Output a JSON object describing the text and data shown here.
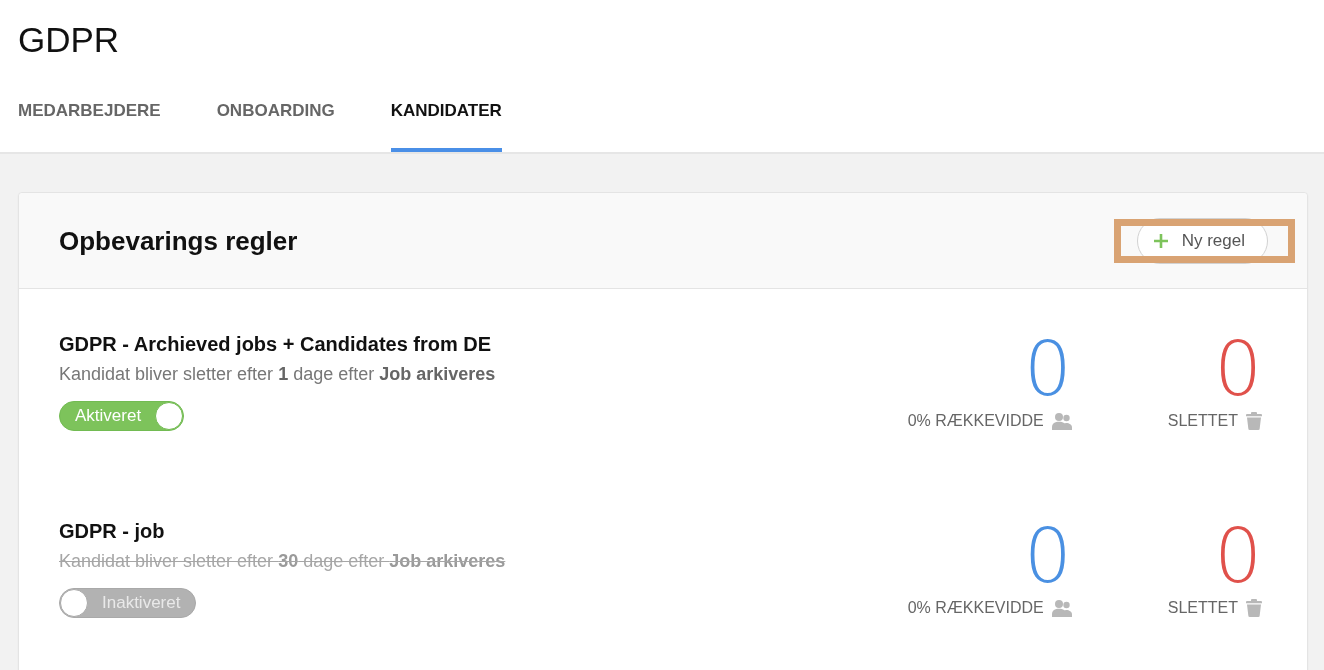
{
  "page": {
    "title": "GDPR"
  },
  "tabs": [
    {
      "label": "MEDARBEJDERE",
      "selected": false
    },
    {
      "label": "ONBOARDING",
      "selected": false
    },
    {
      "label": "KANDIDATER",
      "selected": true
    }
  ],
  "card": {
    "title": "Opbevarings regler",
    "new_rule_button": {
      "label": "Ny regel",
      "highlighted": true
    },
    "rules": [
      {
        "name": "GDPR - Archieved jobs + Candidates from DE",
        "description": "Kandidat bliver sletter efter **1** dage efter **Job arkiveres**",
        "active": true,
        "status_label": "Aktiveret",
        "stats": [
          {
            "kind": "reach",
            "count": "0",
            "label": "0% RÆKKEVIDDE"
          },
          {
            "kind": "deleted",
            "count": "0",
            "label": "SLETTET"
          }
        ]
      },
      {
        "name": "GDPR - job",
        "description": "Kandidat bliver sletter efter **30** dage efter **Job arkiveres**",
        "active": false,
        "status_label": "Inaktiveret",
        "stats": [
          {
            "kind": "reach",
            "count": "0",
            "label": "0% RÆKKEVIDDE"
          },
          {
            "kind": "deleted",
            "count": "0",
            "label": "SLETTET"
          }
        ]
      }
    ]
  }
}
